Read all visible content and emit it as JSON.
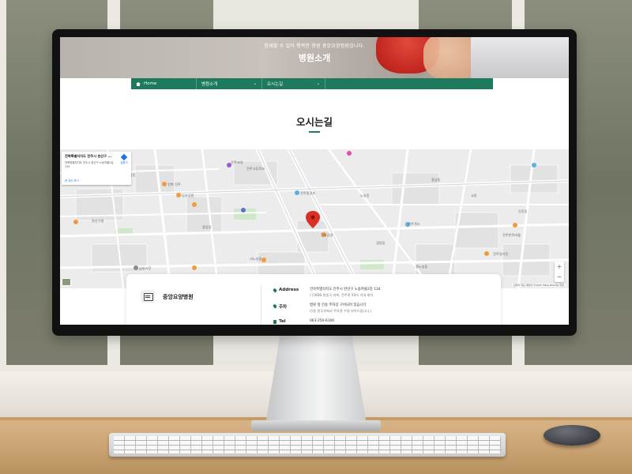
{
  "hero": {
    "subtitle": "함께할 수 있어 행복한 병원 중앙요양병원입니다.",
    "title": "병원소개"
  },
  "nav": {
    "home": "Home",
    "menu1": "병원소개",
    "menu2": "오시는길"
  },
  "page": {
    "heading": "오시는길"
  },
  "map": {
    "infobox": {
      "title": "전북특별자치도 전주시 완산구 ...",
      "address": "전북특별자치도 전주시 완산구 노송여울2길 134",
      "link": "큰 지도 보기",
      "directions": "길찾기"
    },
    "zoom_in": "+",
    "zoom_out": "−",
    "footer": "단축키 지도 데이터 ©2025 TMap Mobility 약관",
    "labels": [
      "전북 전주",
      "다가공원",
      "전주고등학교",
      "전주중앙초",
      "전주교대",
      "다가동",
      "풍남동",
      "교동",
      "전주한옥마을",
      "전주경기전",
      "완산구청",
      "중앙동",
      "경원동",
      "서노송동",
      "전주객사",
      "전라감영",
      "남부시장",
      "중노송동",
      "인후동",
      "노송동"
    ]
  },
  "card": {
    "name": "중앙요양병원",
    "address_label": "Address",
    "address_line1": "전북특별자치도 전주시 완산구 노송여울2길 134",
    "address_line2": "(구)KBS 방송국 좌측, 전주역 50m 이내 위치",
    "parking_label": "주차",
    "parking_line1": "병원 앞 전용 주차장 구비되어 있습니다",
    "parking_line2": "(1층 원무과에서 주차권 수령 부탁드립니다.)",
    "tel_label": "Tel",
    "tel": "063-250-6100"
  },
  "colors": {
    "accent": "#1d7a5c",
    "pin": "#d93025"
  }
}
